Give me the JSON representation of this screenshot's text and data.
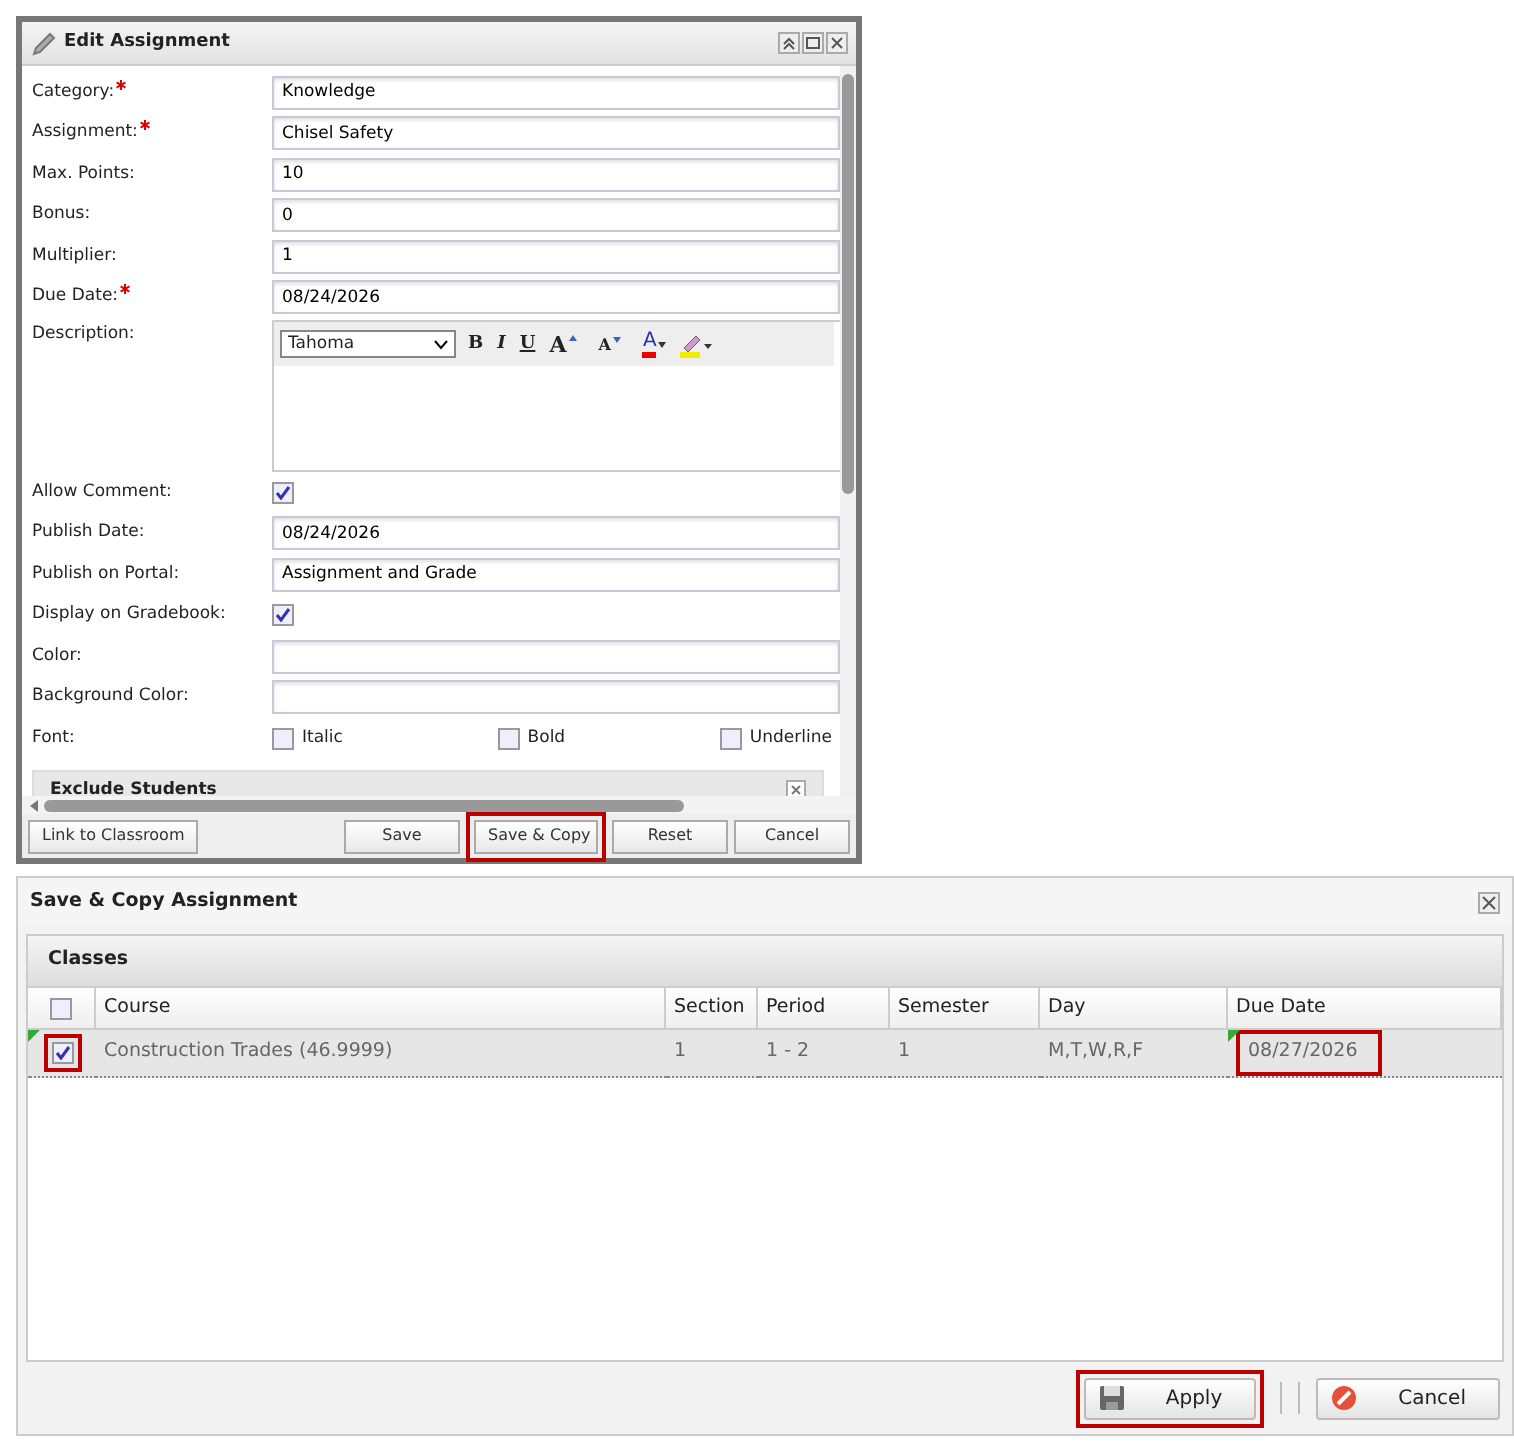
{
  "edit_dialog": {
    "title": "Edit Assignment",
    "fields": [
      {
        "kind": "text",
        "label": "Category:",
        "required": true,
        "value": "Knowledge"
      },
      {
        "kind": "text",
        "label": "Assignment:",
        "required": true,
        "value": "Chisel Safety"
      },
      {
        "kind": "text",
        "label": "Max. Points:",
        "required": false,
        "value": "10"
      },
      {
        "kind": "text",
        "label": "Bonus:",
        "required": false,
        "value": "0"
      },
      {
        "kind": "text",
        "label": "Multiplier:",
        "required": false,
        "value": "1"
      },
      {
        "kind": "text",
        "label": "Due Date:",
        "required": true,
        "value": "08/24/2026"
      },
      {
        "kind": "editor",
        "label": "Description:",
        "required": false,
        "font": "Tahoma",
        "toolbar": [
          {
            "kind": "bold",
            "label": "B"
          },
          {
            "kind": "italic",
            "label": "I"
          },
          {
            "kind": "underline",
            "label": "U"
          },
          {
            "kind": "grow",
            "label": "A"
          },
          {
            "kind": "shrink",
            "label": "A"
          },
          {
            "kind": "font_color",
            "label": "A"
          },
          {
            "kind": "highlight"
          }
        ]
      },
      {
        "kind": "checkbox",
        "label": "Allow Comment:",
        "required": false,
        "checked": true
      },
      {
        "kind": "text",
        "label": "Publish Date:",
        "required": false,
        "value": "08/24/2026"
      },
      {
        "kind": "text",
        "label": "Publish on Portal:",
        "required": false,
        "value": "Assignment and Grade"
      },
      {
        "kind": "checkbox",
        "label": "Display on Gradebook:",
        "required": false,
        "checked": true
      },
      {
        "kind": "text",
        "label": "Color:",
        "required": false
      },
      {
        "kind": "text",
        "label": "Background Color:",
        "required": false
      },
      {
        "kind": "font",
        "label": "Font:",
        "required": false,
        "options": [
          {
            "label": "Italic",
            "checked": false
          },
          {
            "label": "Bold",
            "checked": false
          },
          {
            "label": "Underline",
            "checked": false
          }
        ]
      }
    ],
    "section": "Exclude Students",
    "buttons": [
      {
        "label": "Link to Classroom",
        "highlighted": false
      },
      {
        "label": "Save",
        "highlighted": false
      },
      {
        "label": "Save & Copy",
        "highlighted": true
      },
      {
        "label": "Reset",
        "highlighted": false
      },
      {
        "label": "Cancel",
        "highlighted": false
      }
    ]
  },
  "copy_dialog": {
    "title": "Save & Copy Assignment",
    "panel_title": "Classes",
    "header_checked": false,
    "columns": [
      "Course",
      "Section",
      "Period",
      "Semester",
      "Day",
      "Due Date"
    ],
    "rows": [
      {
        "selected": true,
        "checkbox_highlighted": true,
        "due_highlighted": true,
        "cells": [
          "Construction Trades (46.9999)",
          "1",
          "1 - 2",
          "1",
          "M,T,W,R,F",
          "08/27/2026"
        ]
      }
    ],
    "buttons": [
      {
        "kind": "apply",
        "label": "Apply",
        "highlighted": true
      },
      {
        "kind": "cancel",
        "label": "Cancel",
        "highlighted": false
      }
    ]
  }
}
